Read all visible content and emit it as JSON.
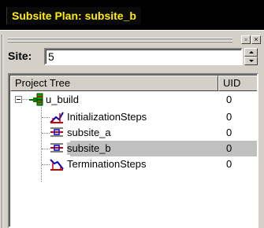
{
  "window": {
    "title": "Subsite Plan: subsite_b"
  },
  "site": {
    "label": "Site:",
    "value": "5"
  },
  "tree": {
    "columns": {
      "name": "Project Tree",
      "uid": "UID"
    },
    "root": {
      "label": "u_build",
      "uid": "0"
    },
    "children": [
      {
        "label": "InitializationSteps",
        "uid": "0",
        "icon": "init-steps-icon"
      },
      {
        "label": "subsite_a",
        "uid": "0",
        "icon": "subsite-icon"
      },
      {
        "label": "subsite_b",
        "uid": "0",
        "icon": "subsite-icon",
        "selected": true
      },
      {
        "label": "TerminationSteps",
        "uid": "0",
        "icon": "term-steps-icon"
      }
    ]
  },
  "colors": {
    "title_bg": "#000000",
    "title_text": "#ffee00",
    "panel": "#d4d0c8",
    "selection": "#c0c0c0"
  }
}
